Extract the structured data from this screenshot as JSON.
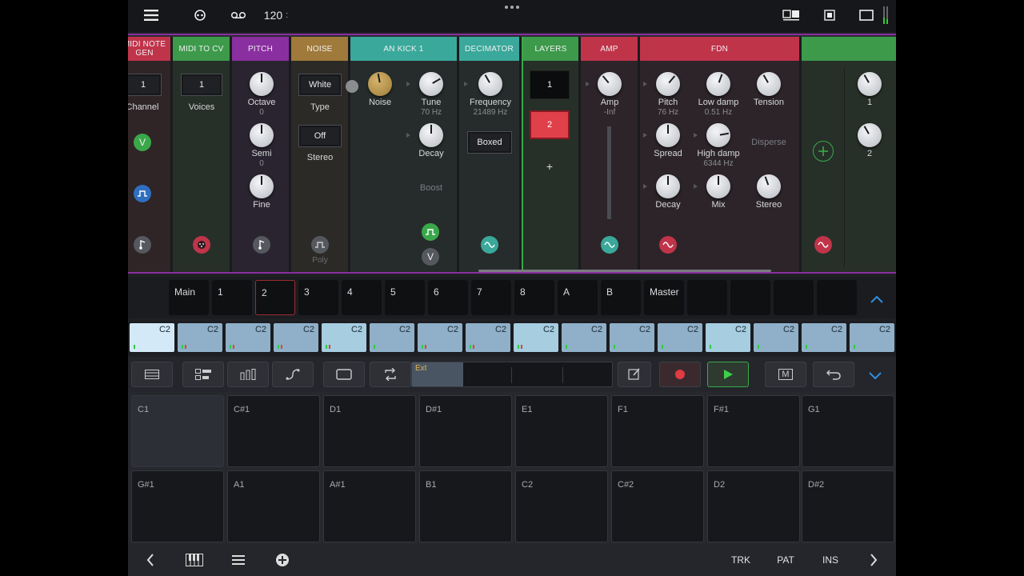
{
  "topbar": {
    "tempo": "120",
    "tempo_suffix": ":"
  },
  "modules": {
    "midi_note_gen": {
      "title": "MIDI NOTE GEN",
      "channel_value": "1",
      "channel_label": "Channel",
      "badge_v": "V"
    },
    "midi_to_cv": {
      "title": "MIDI TO CV",
      "voices_value": "1",
      "voices_label": "Voices"
    },
    "pitch": {
      "title": "PITCH",
      "octave_label": "Octave",
      "octave_value": "0",
      "semi_label": "Semi",
      "semi_value": "0",
      "fine_label": "Fine"
    },
    "noise": {
      "title": "NOISE",
      "type_value": "White",
      "type_label": "Type",
      "stereo_value": "Off",
      "stereo_label": "Stereo",
      "poly_label": "Poly"
    },
    "an_kick": {
      "title": "AN KICK 1",
      "noise_label": "Noise",
      "tune_label": "Tune",
      "tune_value": "70 Hz",
      "decay_label": "Decay",
      "boost_label": "Boost",
      "badge_v": "V"
    },
    "decimator": {
      "title": "DECIMATOR",
      "frequency_label": "Frequency",
      "frequency_value": "21489 Hz",
      "mode_value": "Boxed"
    },
    "layers": {
      "title": "LAYERS",
      "layer1": "1",
      "layer2": "2",
      "add_label": "+"
    },
    "amp": {
      "title": "AMP",
      "amp_label": "Amp",
      "amp_value": "-Inf"
    },
    "fdn": {
      "title": "FDN",
      "pitch_label": "Pitch",
      "pitch_value": "76 Hz",
      "low_damp_label": "Low damp",
      "low_damp_value": "0.51 Hz",
      "tension_label": "Tension",
      "spread_label": "Spread",
      "high_damp_label": "High damp",
      "high_damp_value": "6344 Hz",
      "disperse_label": "Disperse",
      "decay_label": "Decay",
      "mix_label": "Mix",
      "stereo_label": "Stereo"
    },
    "last": {
      "knob1_label": "1",
      "knob2_label": "2"
    }
  },
  "tracks": [
    "Main",
    "1",
    "2",
    "3",
    "4",
    "5",
    "6",
    "7",
    "8",
    "A",
    "B",
    "Master"
  ],
  "steps": [
    "C2",
    "C2",
    "C2",
    "C2",
    "C2",
    "C2",
    "C2",
    "C2",
    "C2",
    "C2",
    "C2",
    "C2",
    "C2",
    "C2",
    "C2",
    "C2"
  ],
  "toolbar": {
    "seq_label": "Ext",
    "m_label": "M"
  },
  "pads_row1": [
    "C1",
    "C#1",
    "D1",
    "D#1",
    "E1",
    "F1",
    "F#1",
    "G1"
  ],
  "pads_row2": [
    "G#1",
    "A1",
    "A#1",
    "B1",
    "C2",
    "C#2",
    "D2",
    "D#2"
  ],
  "bottombar": {
    "trk": "TRK",
    "pat": "PAT",
    "ins": "INS"
  },
  "colors": {
    "midi": "#c0344a",
    "midi_cv": "#3c9a4a",
    "pitch": "#8a2fa0",
    "noise": "#a07a3a",
    "kick": "#3aa89a",
    "decimator": "#3aa89a",
    "layers": "#3c9a4a",
    "amp": "#c0344a",
    "fdn": "#c0344a",
    "accent": "#2f8fe0"
  }
}
